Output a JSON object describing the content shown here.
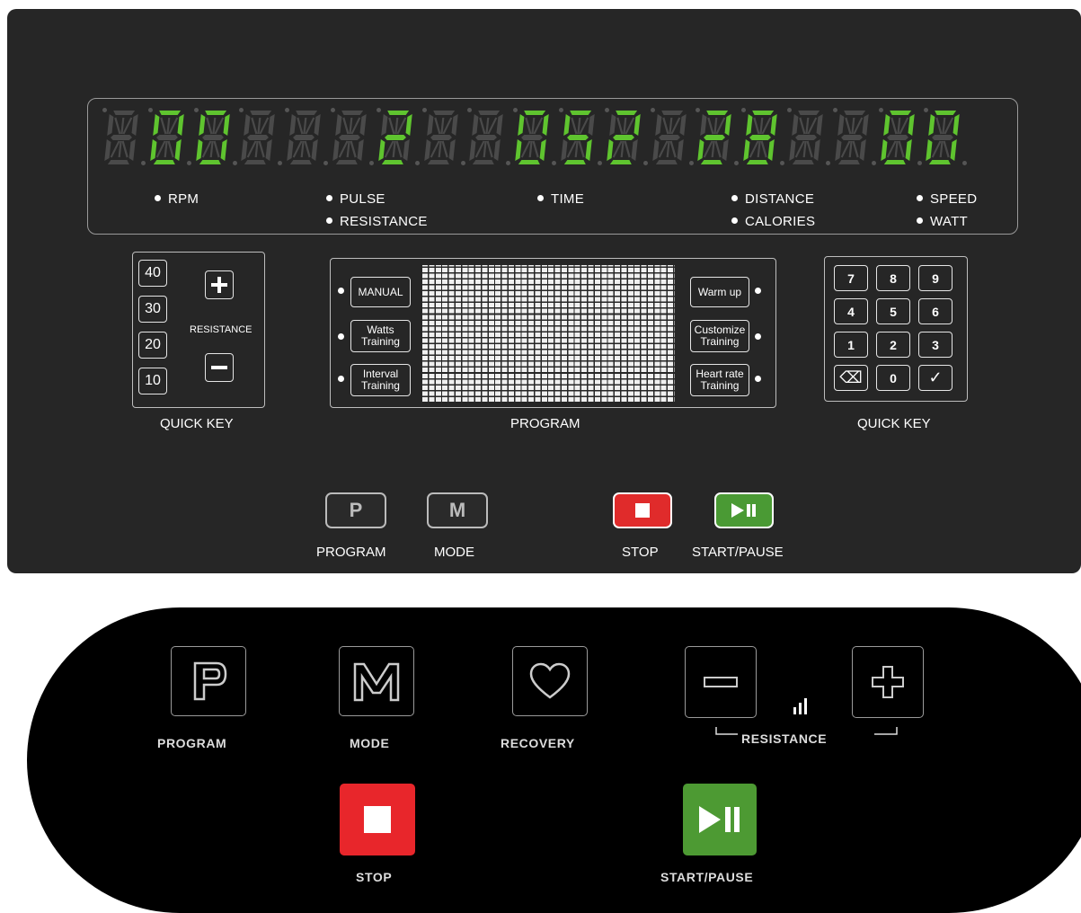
{
  "display": {
    "digits": [
      {
        "char": "",
        "on": false
      },
      {
        "char": "0",
        "on": true
      },
      {
        "char": "0",
        "on": true
      },
      {
        "char": "",
        "on": false
      },
      {
        "char": "",
        "on": false
      },
      {
        "char": "",
        "on": false
      },
      {
        "char": "2",
        "on": true
      },
      {
        "char": "",
        "on": false
      },
      {
        "char": "",
        "on": false
      },
      {
        "char": "0",
        "on": true
      },
      {
        "char": "5",
        "on": true
      },
      {
        "char": "2",
        "on": true
      },
      {
        "char": "",
        "on": false
      },
      {
        "char": "2",
        "on": true
      },
      {
        "char": "8",
        "on": true
      },
      {
        "char": "",
        "on": false
      },
      {
        "char": "",
        "on": false
      },
      {
        "char": "0",
        "on": true
      },
      {
        "char": "0",
        "on": true
      }
    ],
    "labels": {
      "rpm": "RPM",
      "pulse": "PULSE",
      "resistance": "RESISTANCE",
      "time": "TIME",
      "distance": "DISTANCE",
      "calories": "CALORIES",
      "speed": "SPEED",
      "watt": "WATT"
    },
    "colors": {
      "lit": "#5fc42f",
      "unlit": "#4a4a4a"
    }
  },
  "left_quick_key": {
    "values": [
      "40",
      "30",
      "20",
      "10"
    ],
    "plus_icon": "plus-icon",
    "minus_icon": "minus-icon",
    "label": "RESISTANCE",
    "caption": "QUICK KEY"
  },
  "program_panel": {
    "left": [
      "MANUAL",
      "Watts Training",
      "Interval Training"
    ],
    "right": [
      "Warm up",
      "Customize Training",
      "Heart rate Training"
    ],
    "caption": "PROGRAM"
  },
  "keypad": {
    "keys": [
      "7",
      "8",
      "9",
      "4",
      "5",
      "6",
      "1",
      "2",
      "3",
      "⌫",
      "0",
      "✓"
    ],
    "icons": {
      "backspace": "backspace-icon",
      "confirm": "check-icon"
    },
    "caption": "QUICK KEY"
  },
  "function_keys": {
    "program": {
      "glyph": "P",
      "label": "PROGRAM"
    },
    "mode": {
      "glyph": "M",
      "label": "MODE"
    },
    "stop": {
      "label": "STOP",
      "icon": "stop-icon",
      "color": "#e02b2b"
    },
    "start_pause": {
      "label": "START/PAUSE",
      "icon": "play-pause-icon",
      "color": "#4a9a34"
    }
  },
  "lower_panel": {
    "program": {
      "glyph": "P",
      "label": "PROGRAM"
    },
    "mode": {
      "glyph": "M",
      "label": "MODE"
    },
    "recovery": {
      "icon": "heart-icon",
      "label": "RECOVERY"
    },
    "resistance": {
      "label": "RESISTANCE",
      "minus_icon": "minus-icon",
      "plus_icon": "plus-icon",
      "level_icon": "signal-bars-icon"
    },
    "stop": {
      "label": "STOP",
      "icon": "stop-icon",
      "color": "#e8262b"
    },
    "start_pause": {
      "label": "START/PAUSE",
      "icon": "play-pause-icon",
      "color": "#4d9a33"
    }
  }
}
